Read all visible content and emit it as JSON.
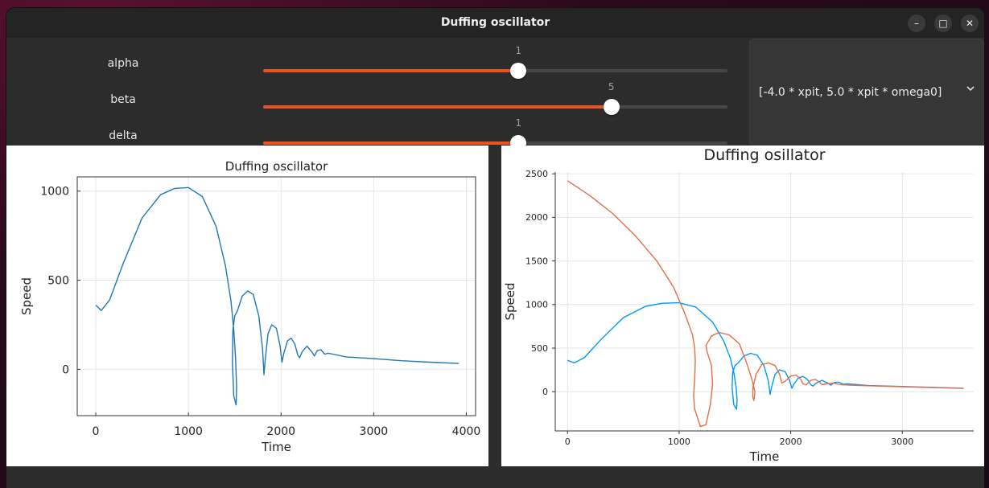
{
  "window": {
    "title": "Duffing oscillator"
  },
  "window_controls": {
    "minimize": "–",
    "maximize": "□",
    "close": "✕"
  },
  "sliders": [
    {
      "label": "alpha",
      "value": "1",
      "fraction": 0.55
    },
    {
      "label": "beta",
      "value": "5",
      "fraction": 0.75
    },
    {
      "label": "delta",
      "value": "1",
      "fraction": 0.55
    }
  ],
  "dropdown": {
    "selected": "[-4.0 * xpit, 5.0 * xpit * omega0]",
    "icon": "chevron-down-icon"
  },
  "colors": {
    "accent": "#e95420",
    "series_blue": "#1f77b4",
    "series_blue2": "#009afa",
    "series_orange": "#e26f46"
  },
  "chart_data": [
    {
      "type": "line",
      "title": "Duffing oscillator",
      "xlabel": "Time",
      "ylabel": "Speed",
      "xlim": [
        -200,
        4100
      ],
      "ylim": [
        -260,
        1080
      ],
      "xticks": [
        0,
        1000,
        2000,
        3000,
        4000
      ],
      "yticks": [
        0,
        500,
        1000
      ],
      "tick_labels_x": [
        "0",
        "1000",
        "2000",
        "3000",
        "4000"
      ],
      "tick_labels_y": [
        "0",
        "500",
        "1000"
      ],
      "grid": true,
      "series": [
        {
          "color": "#1f77b4",
          "points": [
            [
              0,
              360
            ],
            [
              60,
              330
            ],
            [
              150,
              390
            ],
            [
              300,
              600
            ],
            [
              500,
              850
            ],
            [
              700,
              980
            ],
            [
              850,
              1015
            ],
            [
              1000,
              1020
            ],
            [
              1150,
              970
            ],
            [
              1300,
              800
            ],
            [
              1400,
              580
            ],
            [
              1460,
              380
            ],
            [
              1490,
              220
            ],
            [
              1510,
              60
            ],
            [
              1520,
              -100
            ],
            [
              1515,
              -200
            ],
            [
              1490,
              -150
            ],
            [
              1475,
              40
            ],
            [
              1480,
              220
            ],
            [
              1500,
              300
            ],
            [
              1530,
              330
            ],
            [
              1580,
              410
            ],
            [
              1640,
              440
            ],
            [
              1700,
              420
            ],
            [
              1760,
              300
            ],
            [
              1800,
              120
            ],
            [
              1815,
              -30
            ],
            [
              1830,
              60
            ],
            [
              1860,
              200
            ],
            [
              1900,
              250
            ],
            [
              1950,
              230
            ],
            [
              1990,
              130
            ],
            [
              2010,
              40
            ],
            [
              2030,
              90
            ],
            [
              2070,
              160
            ],
            [
              2110,
              175
            ],
            [
              2150,
              140
            ],
            [
              2180,
              80
            ],
            [
              2200,
              65
            ],
            [
              2230,
              100
            ],
            [
              2280,
              130
            ],
            [
              2330,
              100
            ],
            [
              2360,
              75
            ],
            [
              2390,
              105
            ],
            [
              2430,
              110
            ],
            [
              2470,
              85
            ],
            [
              2510,
              90
            ],
            [
              2560,
              85
            ],
            [
              2700,
              70
            ],
            [
              3000,
              60
            ],
            [
              3300,
              48
            ],
            [
              3600,
              40
            ],
            [
              3920,
              33
            ]
          ]
        }
      ]
    },
    {
      "type": "line",
      "title": "Duffing osillator",
      "xlabel": "Time",
      "ylabel": "Speed",
      "xlim": [
        -110,
        3640
      ],
      "ylim": [
        -450,
        2520
      ],
      "xticks": [
        0,
        1000,
        2000,
        3000
      ],
      "yticks": [
        0,
        500,
        1000,
        1500,
        2000,
        2500
      ],
      "tick_labels_x": [
        "0",
        "1000",
        "2000",
        "3000"
      ],
      "tick_labels_y": [
        "0",
        "500",
        "1000",
        "1500",
        "2000",
        "2500"
      ],
      "grid": true,
      "series": [
        {
          "color": "#009afa",
          "points": [
            [
              0,
              360
            ],
            [
              60,
              330
            ],
            [
              150,
              390
            ],
            [
              300,
              600
            ],
            [
              500,
              850
            ],
            [
              700,
              980
            ],
            [
              850,
              1015
            ],
            [
              1000,
              1020
            ],
            [
              1150,
              970
            ],
            [
              1300,
              800
            ],
            [
              1400,
              580
            ],
            [
              1460,
              380
            ],
            [
              1490,
              220
            ],
            [
              1510,
              60
            ],
            [
              1520,
              -100
            ],
            [
              1515,
              -200
            ],
            [
              1490,
              -150
            ],
            [
              1475,
              40
            ],
            [
              1480,
              220
            ],
            [
              1500,
              300
            ],
            [
              1530,
              330
            ],
            [
              1580,
              410
            ],
            [
              1640,
              440
            ],
            [
              1700,
              420
            ],
            [
              1760,
              300
            ],
            [
              1800,
              120
            ],
            [
              1815,
              -30
            ],
            [
              1830,
              60
            ],
            [
              1860,
              200
            ],
            [
              1900,
              250
            ],
            [
              1950,
              230
            ],
            [
              1990,
              130
            ],
            [
              2010,
              40
            ],
            [
              2030,
              90
            ],
            [
              2070,
              160
            ],
            [
              2110,
              175
            ],
            [
              2150,
              140
            ],
            [
              2180,
              80
            ],
            [
              2200,
              65
            ],
            [
              2230,
              100
            ],
            [
              2280,
              130
            ],
            [
              2330,
              100
            ],
            [
              2360,
              75
            ],
            [
              2390,
              105
            ],
            [
              2430,
              110
            ],
            [
              2470,
              85
            ],
            [
              2510,
              90
            ],
            [
              2560,
              85
            ],
            [
              2700,
              70
            ],
            [
              3000,
              60
            ],
            [
              3300,
              48
            ],
            [
              3550,
              40
            ]
          ]
        },
        {
          "color": "#e26f46",
          "points": [
            [
              0,
              2420
            ],
            [
              200,
              2250
            ],
            [
              400,
              2050
            ],
            [
              600,
              1800
            ],
            [
              800,
              1500
            ],
            [
              950,
              1200
            ],
            [
              1050,
              900
            ],
            [
              1120,
              650
            ],
            [
              1140,
              500
            ],
            [
              1145,
              350
            ],
            [
              1140,
              150
            ],
            [
              1130,
              -50
            ],
            [
              1140,
              -200
            ],
            [
              1190,
              -400
            ],
            [
              1240,
              -380
            ],
            [
              1280,
              -150
            ],
            [
              1300,
              80
            ],
            [
              1290,
              300
            ],
            [
              1250,
              460
            ],
            [
              1240,
              530
            ],
            [
              1290,
              640
            ],
            [
              1360,
              680
            ],
            [
              1450,
              650
            ],
            [
              1540,
              550
            ],
            [
              1600,
              350
            ],
            [
              1650,
              150
            ],
            [
              1680,
              0
            ],
            [
              1670,
              -100
            ],
            [
              1660,
              -60
            ],
            [
              1662,
              50
            ],
            [
              1690,
              200
            ],
            [
              1740,
              310
            ],
            [
              1800,
              330
            ],
            [
              1860,
              300
            ],
            [
              1900,
              200
            ],
            [
              1920,
              100
            ],
            [
              1950,
              120
            ],
            [
              2000,
              180
            ],
            [
              2050,
              190
            ],
            [
              2090,
              140
            ],
            [
              2110,
              90
            ],
            [
              2140,
              80
            ],
            [
              2180,
              130
            ],
            [
              2220,
              140
            ],
            [
              2260,
              110
            ],
            [
              2280,
              80
            ],
            [
              2320,
              90
            ],
            [
              2380,
              100
            ],
            [
              2450,
              80
            ],
            [
              2600,
              72
            ],
            [
              2900,
              60
            ],
            [
              3200,
              50
            ],
            [
              3550,
              38
            ]
          ]
        }
      ]
    }
  ]
}
